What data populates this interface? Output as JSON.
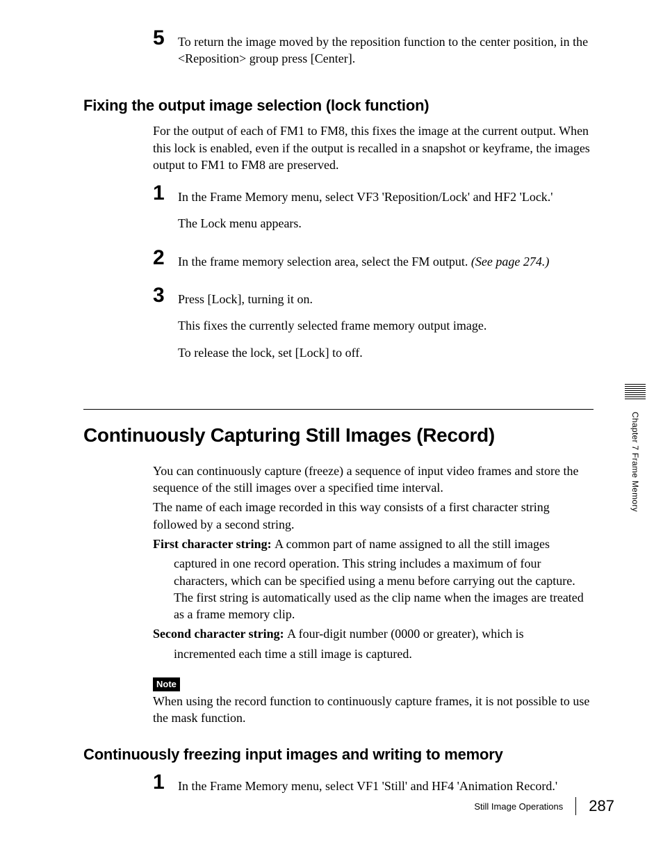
{
  "sidebar": {
    "chapter": "Chapter 7  Frame Memory"
  },
  "step5": {
    "num": "5",
    "text": "To return the image moved by the reposition function to the center position, in the <Reposition> group press [Center]."
  },
  "lockSection": {
    "heading": "Fixing the output image selection (lock function)",
    "intro": "For the output of each of FM1 to FM8, this fixes the image at the current output. When this lock is enabled, even if the output is recalled in a snapshot or keyframe, the images output to FM1 to FM8 are preserved.",
    "steps": [
      {
        "num": "1",
        "body": "In the Frame Memory menu, select VF3 'Reposition/Lock' and HF2 'Lock.'",
        "after": "The Lock menu appears."
      },
      {
        "num": "2",
        "body": "In the frame memory selection area, select the FM output. ",
        "ref": "(See page 274.)"
      },
      {
        "num": "3",
        "body": "Press [Lock], turning it on.",
        "after1": "This fixes the currently selected frame memory output image.",
        "after2": "To release the lock, set [Lock] to off."
      }
    ]
  },
  "recordSection": {
    "heading": "Continuously Capturing Still Images (Record)",
    "p1": "You can continuously capture (freeze) a sequence of input video frames and store the sequence of the still images over a specified time interval.",
    "p2": "The name of each image recorded in this way consists of a first character string followed by a second string.",
    "def1term": "First character string: ",
    "def1body": "A common part of name assigned to all the still images captured in one record operation. This string includes a maximum of four characters, which can be specified using a menu before carrying out the capture. The first string is automatically used as the clip name when the images are treated as a frame memory clip.",
    "def2term": "Second character string: ",
    "def2body": "A four-digit number (0000 or greater), which is incremented each time a still image is captured.",
    "noteLabel": "Note",
    "noteBody": "When using the record function to continuously capture frames, it is not possible to use the mask function."
  },
  "freezeSection": {
    "heading": "Continuously freezing input images and writing to memory",
    "step1": {
      "num": "1",
      "body": "In the Frame Memory menu, select VF1 'Still' and HF4 'Animation Record.'"
    }
  },
  "footer": {
    "title": "Still Image Operations",
    "page": "287"
  }
}
